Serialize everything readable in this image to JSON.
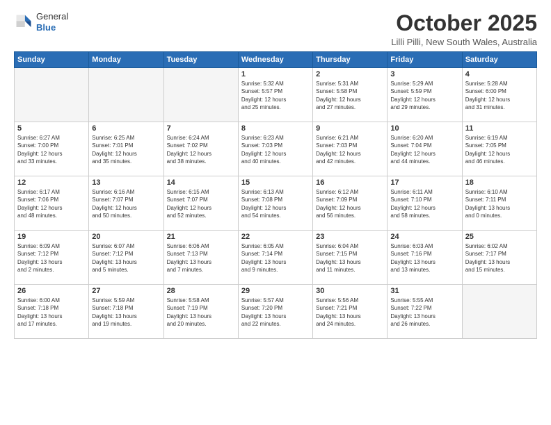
{
  "header": {
    "logo_general": "General",
    "logo_blue": "Blue",
    "month": "October 2025",
    "location": "Lilli Pilli, New South Wales, Australia"
  },
  "days_of_week": [
    "Sunday",
    "Monday",
    "Tuesday",
    "Wednesday",
    "Thursday",
    "Friday",
    "Saturday"
  ],
  "weeks": [
    [
      {
        "day": "",
        "info": ""
      },
      {
        "day": "",
        "info": ""
      },
      {
        "day": "",
        "info": ""
      },
      {
        "day": "1",
        "info": "Sunrise: 5:32 AM\nSunset: 5:57 PM\nDaylight: 12 hours\nand 25 minutes."
      },
      {
        "day": "2",
        "info": "Sunrise: 5:31 AM\nSunset: 5:58 PM\nDaylight: 12 hours\nand 27 minutes."
      },
      {
        "day": "3",
        "info": "Sunrise: 5:29 AM\nSunset: 5:59 PM\nDaylight: 12 hours\nand 29 minutes."
      },
      {
        "day": "4",
        "info": "Sunrise: 5:28 AM\nSunset: 6:00 PM\nDaylight: 12 hours\nand 31 minutes."
      }
    ],
    [
      {
        "day": "5",
        "info": "Sunrise: 6:27 AM\nSunset: 7:00 PM\nDaylight: 12 hours\nand 33 minutes."
      },
      {
        "day": "6",
        "info": "Sunrise: 6:25 AM\nSunset: 7:01 PM\nDaylight: 12 hours\nand 35 minutes."
      },
      {
        "day": "7",
        "info": "Sunrise: 6:24 AM\nSunset: 7:02 PM\nDaylight: 12 hours\nand 38 minutes."
      },
      {
        "day": "8",
        "info": "Sunrise: 6:23 AM\nSunset: 7:03 PM\nDaylight: 12 hours\nand 40 minutes."
      },
      {
        "day": "9",
        "info": "Sunrise: 6:21 AM\nSunset: 7:03 PM\nDaylight: 12 hours\nand 42 minutes."
      },
      {
        "day": "10",
        "info": "Sunrise: 6:20 AM\nSunset: 7:04 PM\nDaylight: 12 hours\nand 44 minutes."
      },
      {
        "day": "11",
        "info": "Sunrise: 6:19 AM\nSunset: 7:05 PM\nDaylight: 12 hours\nand 46 minutes."
      }
    ],
    [
      {
        "day": "12",
        "info": "Sunrise: 6:17 AM\nSunset: 7:06 PM\nDaylight: 12 hours\nand 48 minutes."
      },
      {
        "day": "13",
        "info": "Sunrise: 6:16 AM\nSunset: 7:07 PM\nDaylight: 12 hours\nand 50 minutes."
      },
      {
        "day": "14",
        "info": "Sunrise: 6:15 AM\nSunset: 7:07 PM\nDaylight: 12 hours\nand 52 minutes."
      },
      {
        "day": "15",
        "info": "Sunrise: 6:13 AM\nSunset: 7:08 PM\nDaylight: 12 hours\nand 54 minutes."
      },
      {
        "day": "16",
        "info": "Sunrise: 6:12 AM\nSunset: 7:09 PM\nDaylight: 12 hours\nand 56 minutes."
      },
      {
        "day": "17",
        "info": "Sunrise: 6:11 AM\nSunset: 7:10 PM\nDaylight: 12 hours\nand 58 minutes."
      },
      {
        "day": "18",
        "info": "Sunrise: 6:10 AM\nSunset: 7:11 PM\nDaylight: 13 hours\nand 0 minutes."
      }
    ],
    [
      {
        "day": "19",
        "info": "Sunrise: 6:09 AM\nSunset: 7:12 PM\nDaylight: 13 hours\nand 2 minutes."
      },
      {
        "day": "20",
        "info": "Sunrise: 6:07 AM\nSunset: 7:12 PM\nDaylight: 13 hours\nand 5 minutes."
      },
      {
        "day": "21",
        "info": "Sunrise: 6:06 AM\nSunset: 7:13 PM\nDaylight: 13 hours\nand 7 minutes."
      },
      {
        "day": "22",
        "info": "Sunrise: 6:05 AM\nSunset: 7:14 PM\nDaylight: 13 hours\nand 9 minutes."
      },
      {
        "day": "23",
        "info": "Sunrise: 6:04 AM\nSunset: 7:15 PM\nDaylight: 13 hours\nand 11 minutes."
      },
      {
        "day": "24",
        "info": "Sunrise: 6:03 AM\nSunset: 7:16 PM\nDaylight: 13 hours\nand 13 minutes."
      },
      {
        "day": "25",
        "info": "Sunrise: 6:02 AM\nSunset: 7:17 PM\nDaylight: 13 hours\nand 15 minutes."
      }
    ],
    [
      {
        "day": "26",
        "info": "Sunrise: 6:00 AM\nSunset: 7:18 PM\nDaylight: 13 hours\nand 17 minutes."
      },
      {
        "day": "27",
        "info": "Sunrise: 5:59 AM\nSunset: 7:18 PM\nDaylight: 13 hours\nand 19 minutes."
      },
      {
        "day": "28",
        "info": "Sunrise: 5:58 AM\nSunset: 7:19 PM\nDaylight: 13 hours\nand 20 minutes."
      },
      {
        "day": "29",
        "info": "Sunrise: 5:57 AM\nSunset: 7:20 PM\nDaylight: 13 hours\nand 22 minutes."
      },
      {
        "day": "30",
        "info": "Sunrise: 5:56 AM\nSunset: 7:21 PM\nDaylight: 13 hours\nand 24 minutes."
      },
      {
        "day": "31",
        "info": "Sunrise: 5:55 AM\nSunset: 7:22 PM\nDaylight: 13 hours\nand 26 minutes."
      },
      {
        "day": "",
        "info": ""
      }
    ]
  ]
}
